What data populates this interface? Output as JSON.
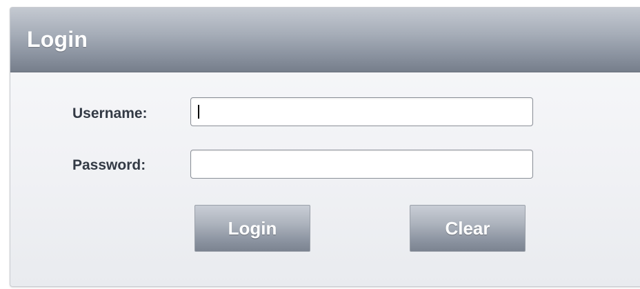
{
  "panel": {
    "title": "Login"
  },
  "form": {
    "username_label": "Username:",
    "username_value": "",
    "password_label": "Password:",
    "password_value": ""
  },
  "buttons": {
    "login_label": "Login",
    "clear_label": "Clear"
  },
  "colors": {
    "header_gradient_top": "#c4c9d1",
    "header_gradient_bottom": "#767e8b",
    "label_text": "#333a45",
    "button_text": "#ffffff"
  }
}
